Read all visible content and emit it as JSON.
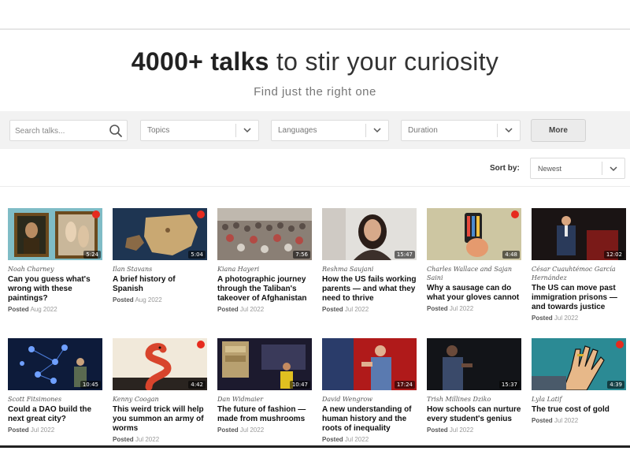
{
  "hero": {
    "title_bold": "4000+ talks",
    "title_rest": " to stir your curiosity",
    "subtitle": "Find just the right one"
  },
  "filters": {
    "search_placeholder": "Search talks...",
    "topics_label": "Topics",
    "languages_label": "Languages",
    "duration_label": "Duration",
    "more_label": "More"
  },
  "sort": {
    "label": "Sort by:",
    "value": "Newest"
  },
  "posted_prefix": "Posted",
  "talks": [
    {
      "speaker": "Noah Charney",
      "title": "Can you guess what's wrong with these paintings?",
      "posted": "Aug 2022",
      "duration": "5:24"
    },
    {
      "speaker": "Ilan Stavans",
      "title": "A brief history of Spanish",
      "posted": "Aug 2022",
      "duration": "5:04"
    },
    {
      "speaker": "Kiana Hayeri",
      "title": "A photographic journey through the Taliban's takeover of Afghanistan",
      "posted": "Jul 2022",
      "duration": "7:56"
    },
    {
      "speaker": "Reshma Saujani",
      "title": "How the US fails working parents — and what they need to thrive",
      "posted": "Jul 2022",
      "duration": "15:47"
    },
    {
      "speaker": "Charles Wallace and Sajan Saini",
      "title": "Why a sausage can do what your gloves cannot",
      "posted": "Jul 2022",
      "duration": "4:48"
    },
    {
      "speaker": "César Cuauhtémoc García Hernández",
      "title": "The US can move past immigration prisons — and towards justice",
      "posted": "Jul 2022",
      "duration": "12:02"
    },
    {
      "speaker": "Scott Fitsimones",
      "title": "Could a DAO build the next great city?",
      "posted": "Jul 2022",
      "duration": "10:45"
    },
    {
      "speaker": "Kenny Coogan",
      "title": "This weird trick will help you summon an army of worms",
      "posted": "Jul 2022",
      "duration": "4:42"
    },
    {
      "speaker": "Dan Widmaier",
      "title": "The future of fashion — made from mushrooms",
      "posted": "Jul 2022",
      "duration": "10:47"
    },
    {
      "speaker": "David Wengrow",
      "title": "A new understanding of human history and the roots of inequality",
      "posted": "Jul 2022",
      "duration": "17:24"
    },
    {
      "speaker": "Trish Millines Dziko",
      "title": "How schools can nurture every student's genius",
      "posted": "Jul 2022",
      "duration": "15:37"
    },
    {
      "speaker": "Lyla Latif",
      "title": "The true cost of gold",
      "posted": "Jul 2022",
      "duration": "4:39"
    }
  ],
  "icons": {
    "search": "magnifier-icon",
    "dropdown": "chevron-down-icon",
    "badge": "red-dot-badge"
  },
  "colors": {
    "accent_red": "#e62b1e",
    "filter_bar_bg": "#f2f2f2"
  }
}
